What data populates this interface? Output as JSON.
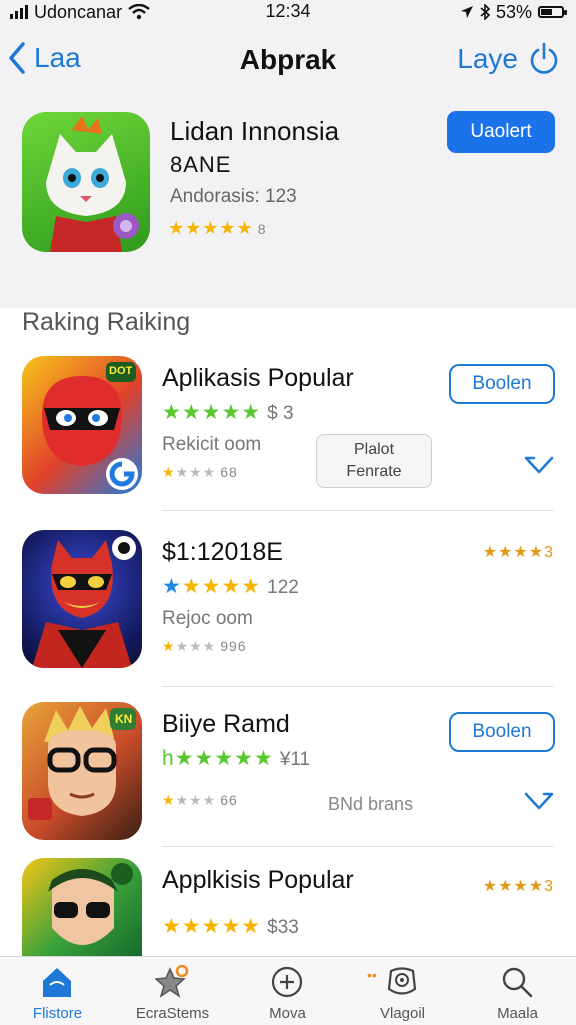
{
  "status_bar": {
    "carrier": "Udoncanar",
    "time": "12:34",
    "battery": "53%",
    "battery_level": 0.53
  },
  "nav": {
    "back_label": "Laa",
    "title": "Abprak",
    "right_label": "Laye"
  },
  "featured": {
    "title": "Lidan Innonsia",
    "subtitle": "8ANE",
    "meta": "Andorasis: 123",
    "stars": "★★★★★",
    "star_note": "8",
    "button": "Uaolert"
  },
  "section_title": "Raking Raiking",
  "apps": [
    {
      "name": "Aplikasis Popular",
      "stars": "★★★★★",
      "star_color": "#5ac72e",
      "rating_text": "$ 3",
      "meta": "Rekicit oom",
      "small_stars_filled": "★",
      "small_stars_empty": "★★★",
      "small_stars_num": "68",
      "button": "Boolen",
      "grey_button_line1": "Plalot",
      "grey_button_line2": "Fenrate",
      "icon_badge": "DOT"
    },
    {
      "name": "$1:12018E",
      "stars": "★★★★★",
      "star_color": "#f4b400",
      "rating_text": "122",
      "meta": "Rejoc oom",
      "small_stars_filled": "★",
      "small_stars_empty": "★★★",
      "small_stars_num": "996",
      "rating_right": "★★★★3"
    },
    {
      "name": "Biiye Ramd",
      "stars": "★★★★★",
      "star_color": "#5ac72e",
      "rating_text": "¥11",
      "meta_prefix": "h",
      "small_stars_filled": "★",
      "small_stars_empty": "★★★",
      "small_stars_num": "66",
      "right_text": "BNd brans",
      "button": "Boolen",
      "icon_badge": "KN"
    },
    {
      "name": "Applkisis Popular",
      "stars": "★★★★★",
      "star_color": "#f4b400",
      "rating_text": "$33",
      "rating_right": "★★★★3"
    }
  ],
  "tabs": [
    {
      "label": "Flistore",
      "icon": "store-icon"
    },
    {
      "label": "EcraStems",
      "icon": "star-icon"
    },
    {
      "label": "Mova",
      "icon": "plus-circle-icon"
    },
    {
      "label": "Vlagoil",
      "icon": "compass-icon"
    },
    {
      "label": "Maala",
      "icon": "search-icon"
    }
  ],
  "colors": {
    "accent": "#1e78d6",
    "button_fill": "#1a73e8",
    "star_gold": "#f4b400",
    "star_green": "#5ac72e"
  }
}
